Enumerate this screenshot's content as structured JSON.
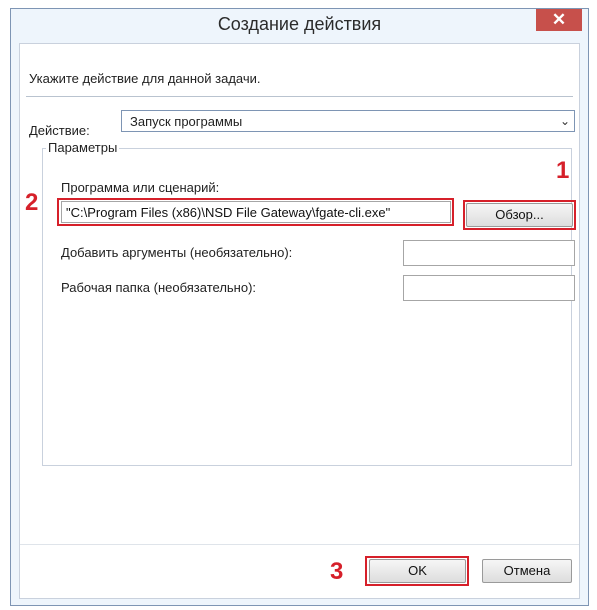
{
  "window": {
    "title": "Создание действия",
    "close_glyph": "✕"
  },
  "instruction": "Укажите действие для данной задачи.",
  "action": {
    "label": "Действие:",
    "value": "Запуск программы",
    "arrow": "⌄"
  },
  "params": {
    "legend": "Параметры",
    "program_label": "Программа или сценарий:",
    "program_value": "\"C:\\Program Files (x86)\\NSD File Gateway\\fgate-cli.exe\"",
    "browse_label": "Обзор...",
    "args_label": "Добавить аргументы (необязательно):",
    "args_value": "",
    "workdir_label": "Рабочая папка (необязательно):",
    "workdir_value": ""
  },
  "buttons": {
    "ok": "OK",
    "cancel": "Отмена"
  },
  "annotations": {
    "n1": "1",
    "n2": "2",
    "n3": "3"
  },
  "colors": {
    "highlight": "#d6202a",
    "close_bg": "#c7504b",
    "window_bg": "#eef5fc"
  }
}
